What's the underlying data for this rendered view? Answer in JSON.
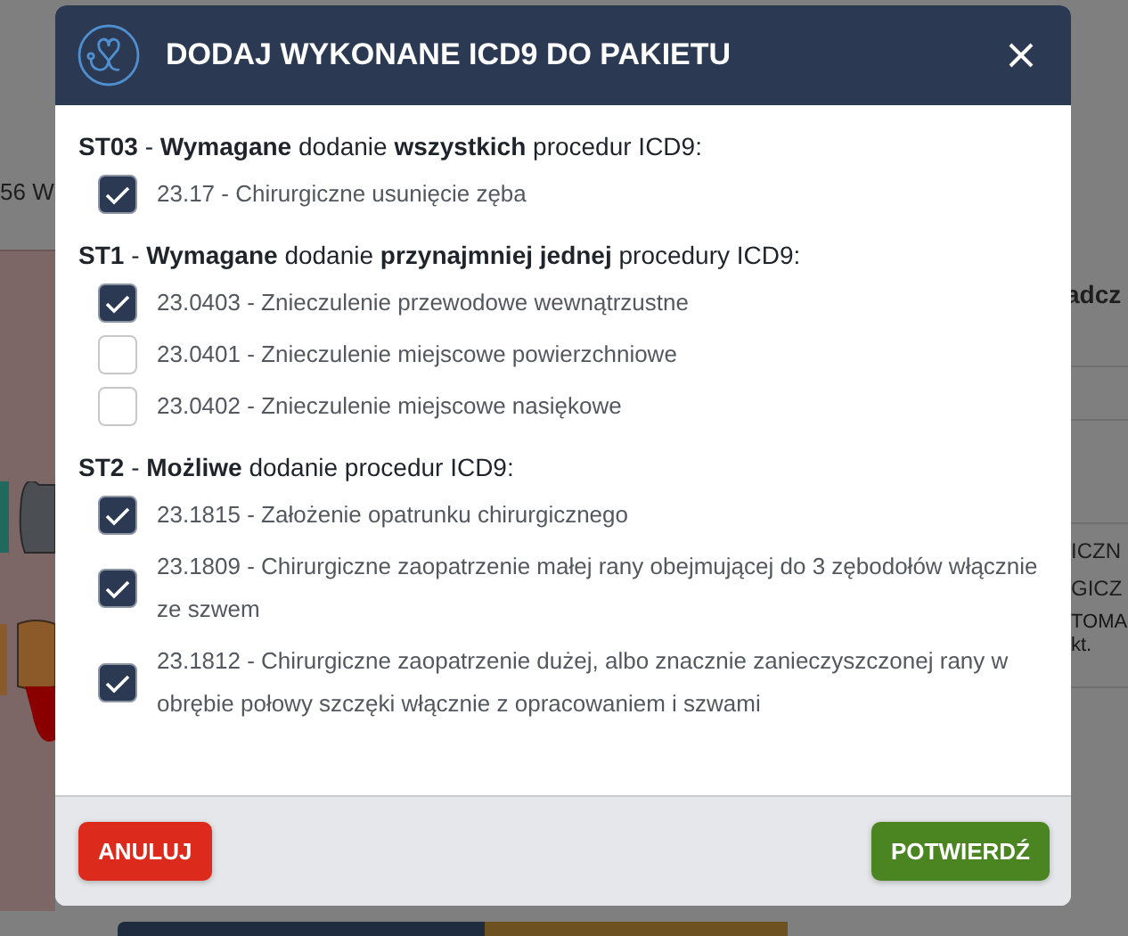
{
  "background": {
    "texts": [
      {
        "kind": "left",
        "text": "56 W"
      },
      {
        "kind": "right-bold",
        "text": "adcz"
      },
      {
        "kind": "right",
        "text": "ICZN"
      },
      {
        "kind": "right",
        "text": "GICZ"
      },
      {
        "kind": "right-small",
        "text": "TOMA"
      },
      {
        "kind": "right-small",
        "text": "kt."
      }
    ]
  },
  "dialog": {
    "title": "DODAJ WYKONANE ICD9 DO PAKIETU",
    "sections": [
      {
        "heading": "**ST03** - **Wymagane** dodanie **wszystkich** procedur ICD9:",
        "items": [
          {
            "label": "23.17 - Chirurgiczne usunięcie zęba",
            "checked": true
          }
        ]
      },
      {
        "heading": "**ST1** - **Wymagane** dodanie **przynajmniej jednej** procedury ICD9:",
        "items": [
          {
            "label": "23.0403 - Znieczulenie przewodowe wewnątrzustne",
            "checked": true
          },
          {
            "label": "23.0401 - Znieczulenie miejscowe powierzchniowe",
            "checked": false
          },
          {
            "label": "23.0402 - Znieczulenie miejscowe nasiękowe",
            "checked": false
          }
        ]
      },
      {
        "heading": "**ST2** - **Możliwe** dodanie procedur ICD9:",
        "items": [
          {
            "label": "23.1815 - Założenie opatrunku chirurgicznego",
            "checked": true
          },
          {
            "label": "23.1809 - Chirurgiczne zaopatrzenie małej rany obejmującej do 3 zębodołów włącznie ze szwem",
            "checked": true
          },
          {
            "label": "23.1812 - Chirurgiczne zaopatrzenie dużej, albo znacznie zanieczyszczonej rany w obrębie połowy szczęki włącznie z opracowaniem i szwami",
            "checked": true
          }
        ]
      }
    ],
    "buttons": [
      {
        "kind": "cancel",
        "label": "ANULUJ"
      },
      {
        "kind": "confirm",
        "label": "POTWIERDŹ"
      }
    ]
  }
}
